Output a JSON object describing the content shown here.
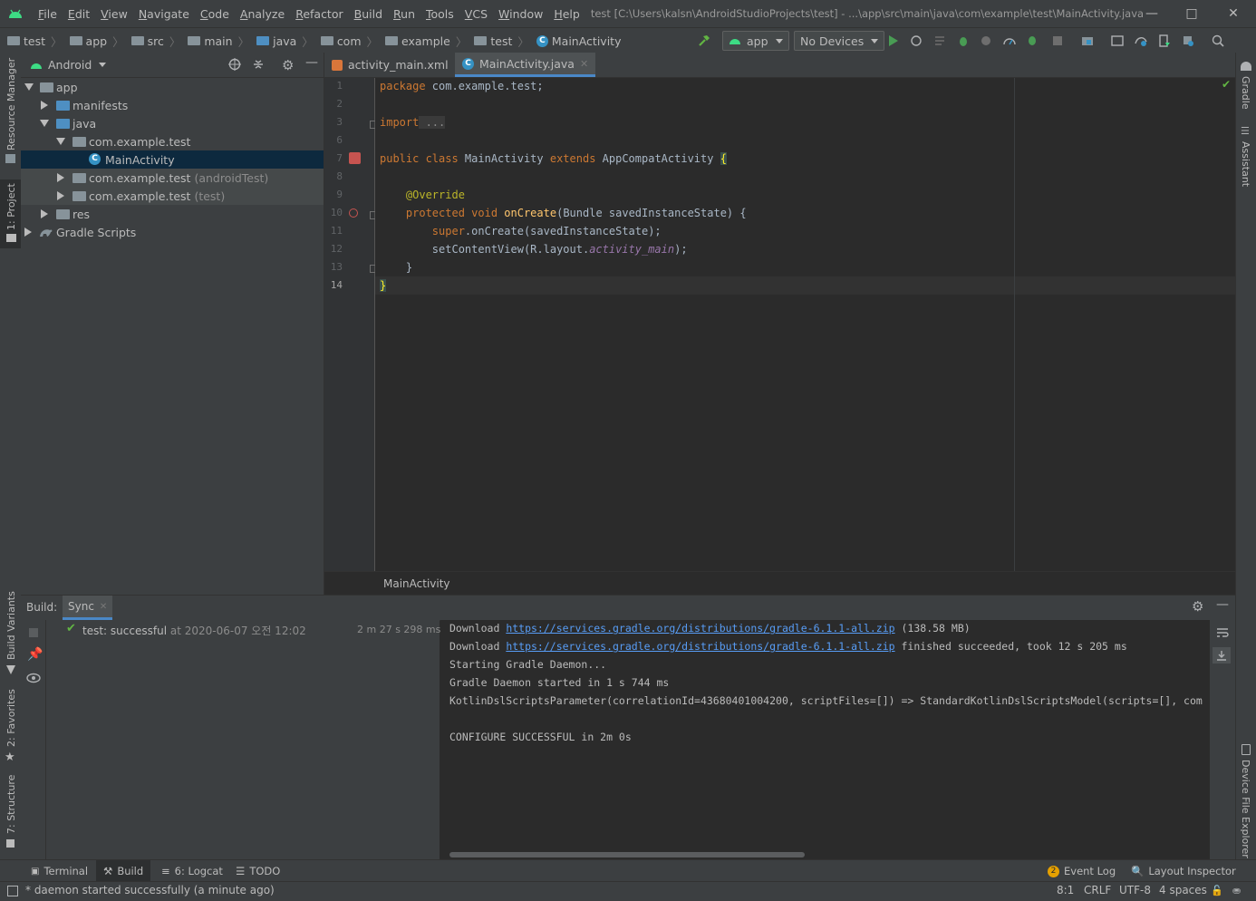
{
  "app_title": "test [C:\\Users\\kalsn\\AndroidStudioProjects\\test] - ...\\app\\src\\main\\java\\com\\example\\test\\MainActivity.java",
  "menu": [
    "File",
    "Edit",
    "View",
    "Navigate",
    "Code",
    "Analyze",
    "Refactor",
    "Build",
    "Run",
    "Tools",
    "VCS",
    "Window",
    "Help"
  ],
  "breadcrumb": [
    "test",
    "app",
    "src",
    "main",
    "java",
    "com",
    "example",
    "test",
    "MainActivity"
  ],
  "toolbar": {
    "config": "app",
    "devices": "No Devices"
  },
  "project_panel": {
    "view": "Android",
    "tree": [
      {
        "label": "app"
      },
      {
        "label": "manifests"
      },
      {
        "label": "java"
      },
      {
        "label": "com.example.test"
      },
      {
        "label": "MainActivity"
      },
      {
        "label": "com.example.test",
        "note": "(androidTest)"
      },
      {
        "label": "com.example.test",
        "note": "(test)"
      },
      {
        "label": "res"
      },
      {
        "label": "Gradle Scripts"
      }
    ]
  },
  "editor": {
    "tabs": [
      "activity_main.xml",
      "MainActivity.java"
    ],
    "line_numbers": [
      "1",
      "2",
      "3",
      "6",
      "7",
      "8",
      "9",
      "10",
      "11",
      "12",
      "13",
      "14"
    ],
    "code": {
      "pkg_kw": "package",
      "pkg_name": " com.example.test;",
      "import_kw": "import",
      "import_fold": " ...",
      "class_mods": "public class",
      "class_name": " MainActivity ",
      "extends_kw": "extends",
      "superclass": " AppCompatActivity ",
      "open_brace": "{",
      "annotation": "@Override",
      "method_mods": "protected void",
      "method_name": " onCreate",
      "method_params": "(Bundle savedInstanceState) {",
      "super_kw": "super",
      "super_call": ".onCreate(savedInstanceState);",
      "setcv": "setContentView(R.layout.",
      "layout_ref": "activity_main",
      "setcv_end": ");",
      "close_method": "}",
      "close_class": "}"
    },
    "footer_breadcrumb": "MainActivity"
  },
  "build_panel": {
    "label": "Build:",
    "tab": "Sync",
    "result_name": "test:",
    "result_status": "successful",
    "result_time": "at 2020-06-07 오전 12:02",
    "duration": "2 m 27 s 298 ms",
    "console": {
      "l1_pre": "Download ",
      "l1_link": "https://services.gradle.org/distributions/gradle-6.1.1-all.zip",
      "l1_post": " (138.58 MB)",
      "l2_pre": "Download ",
      "l2_link": "https://services.gradle.org/distributions/gradle-6.1.1-all.zip",
      "l2_post": " finished succeeded, took 12 s 205 ms",
      "l3": "Starting Gradle Daemon...",
      "l4": "Gradle Daemon started in 1 s 744 ms",
      "l5": "KotlinDslScriptsParameter(correlationId=43680401004200, scriptFiles=[]) => StandardKotlinDslScriptsModel(scripts=[], com",
      "l6": "CONFIGURE SUCCESSFUL in 2m 0s"
    }
  },
  "side_tabs": {
    "left_top": [
      "Resource Manager",
      "1: Project"
    ],
    "left_bottom": [
      "Build Variants",
      "2: Favorites",
      "7: Structure"
    ],
    "right_top": [
      "Gradle",
      "Assistant"
    ],
    "right_bottom": [
      "Device File Explorer"
    ]
  },
  "bottom_tabs": [
    "Terminal",
    "Build",
    "6: Logcat",
    "TODO"
  ],
  "bottom_right_tabs": {
    "event_log_count": "2",
    "event_log": "Event Log",
    "layout_inspector": "Layout Inspector"
  },
  "status": {
    "message": "* daemon started successfully (a minute ago)",
    "position": "8:1",
    "line_sep": "CRLF",
    "encoding": "UTF-8",
    "indent": "4 spaces"
  }
}
